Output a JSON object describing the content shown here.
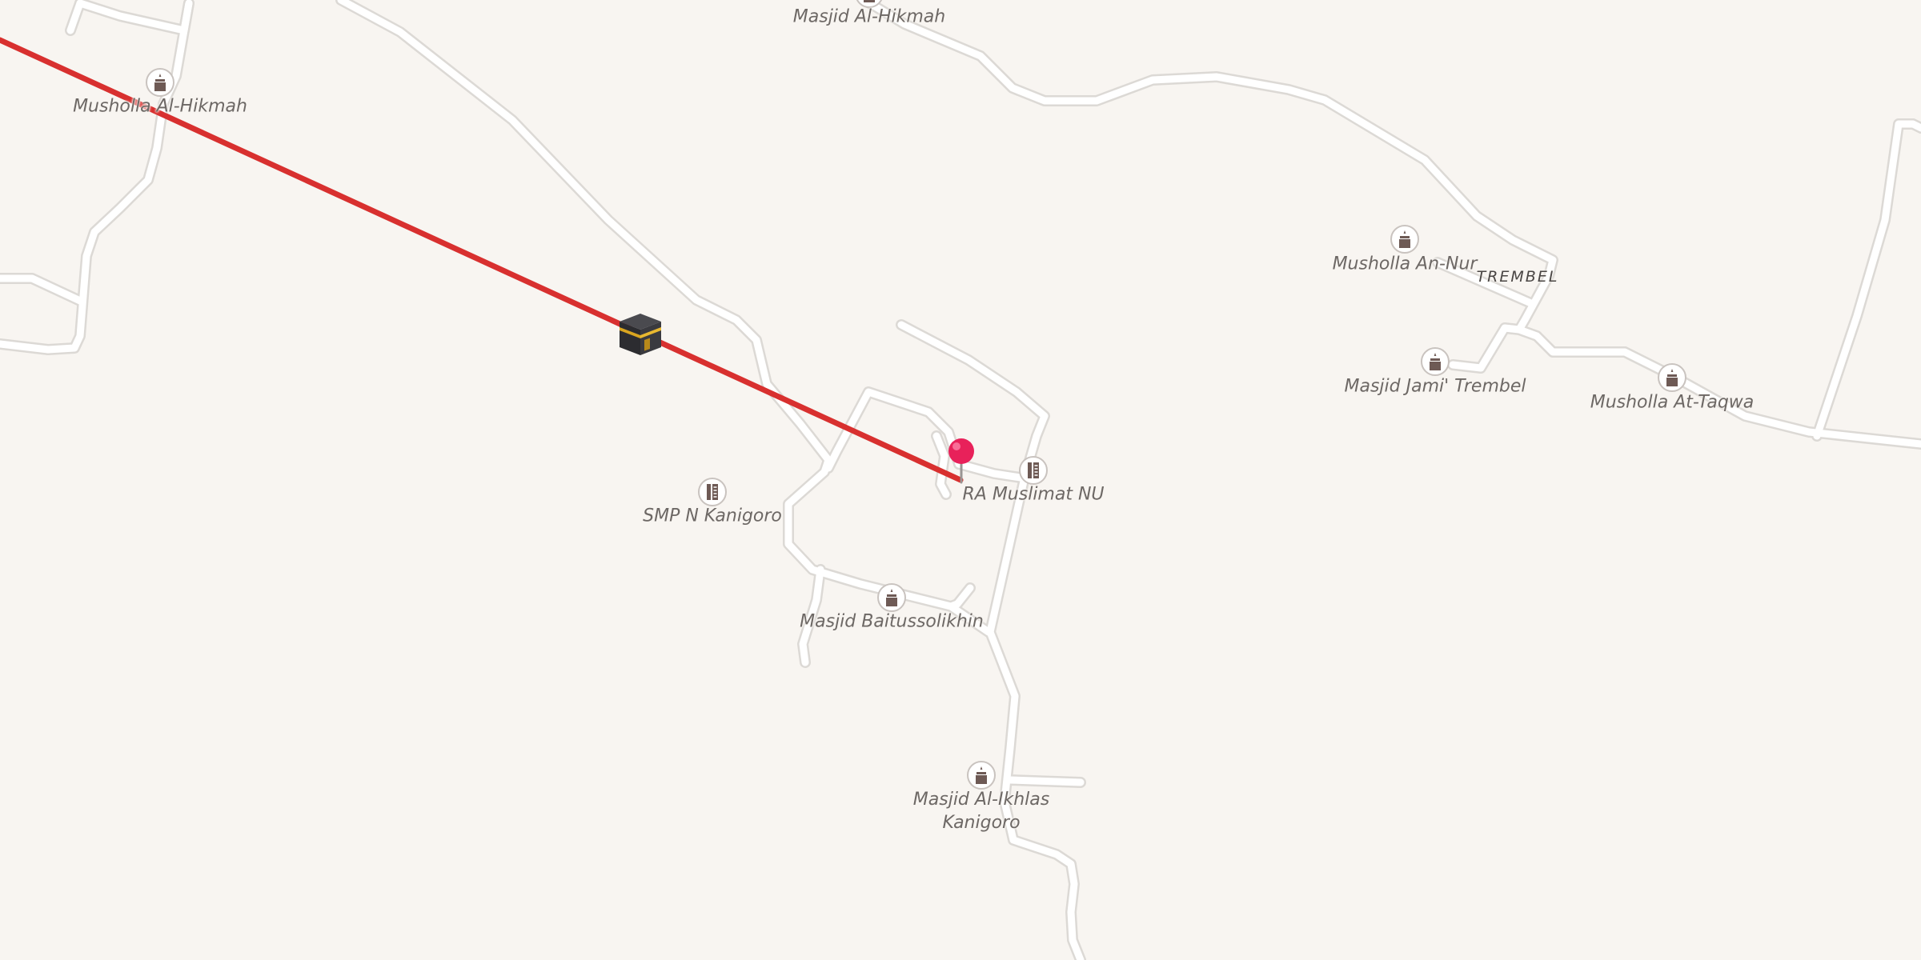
{
  "map": {
    "places": {
      "trembel": "TREMBEL"
    },
    "pois": {
      "masjid_al_hikmah": {
        "name": "Masjid Al-Hikmah",
        "icon": "mosque-icon"
      },
      "musholla_al_hikmah": {
        "name": "Musholla Al-Hikmah",
        "icon": "mosque-icon"
      },
      "musholla_an_nur": {
        "name": "Musholla An-Nur",
        "icon": "mosque-icon"
      },
      "masjid_jami_trembel": {
        "name": "Masjid Jami' Trembel",
        "icon": "mosque-icon"
      },
      "musholla_at_taqwa": {
        "name": "Musholla At-Taqwa",
        "icon": "mosque-icon"
      },
      "smp_n_kanigoro": {
        "name": "SMP N Kanigoro",
        "icon": "school-icon"
      },
      "ra_muslimat_nu": {
        "name": "RA Muslimat NU",
        "icon": "school-icon"
      },
      "masjid_baitussolikhin": {
        "name": "Masjid Baitussolikhin",
        "icon": "mosque-icon"
      },
      "masjid_al_ikhlas_kanigoro": {
        "name_line1": "Masjid Al-Ikhlas",
        "name_line2": "Kanigoro",
        "icon": "mosque-icon"
      }
    },
    "qibla_marker": {
      "icon": "kaaba-icon"
    },
    "location_marker": {
      "icon": "location-pin-icon"
    },
    "colors": {
      "background": "#f8f5f1",
      "road": "#ffffff",
      "road_casing": "#dcd9d5",
      "qibla_line": "#d8302f",
      "poi_icon": "#6e5a55",
      "pin": "#e8215a"
    }
  }
}
